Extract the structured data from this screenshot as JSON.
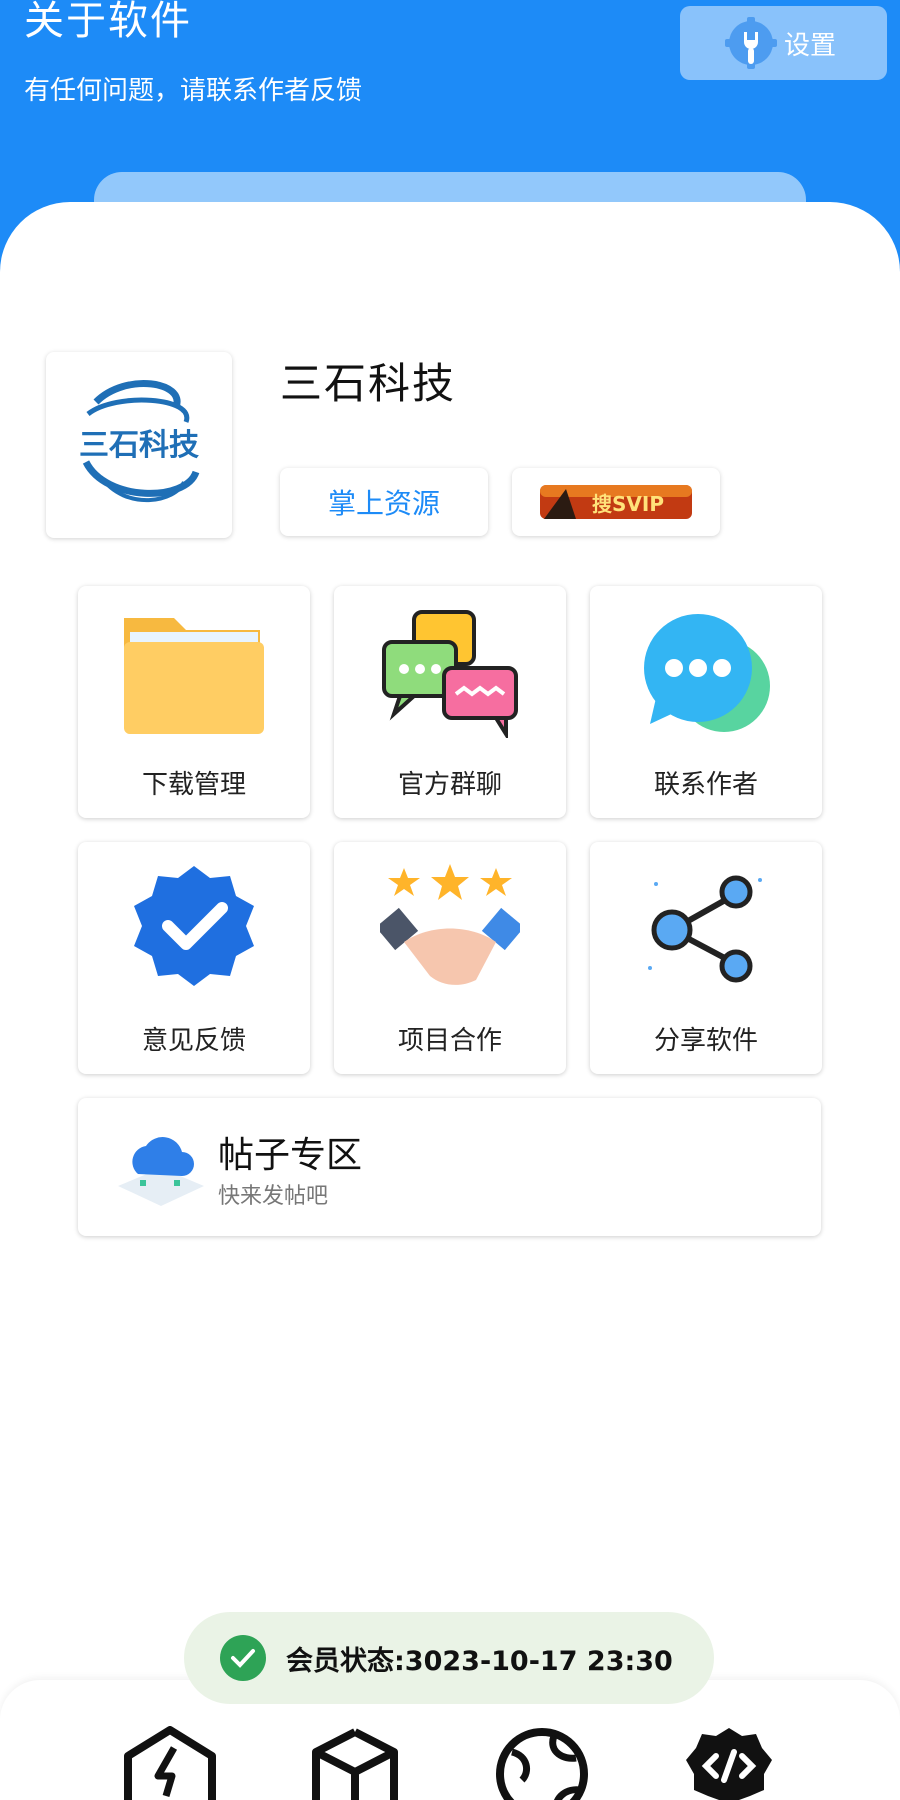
{
  "header": {
    "title": "关于软件",
    "subtitle": "有任何问题，请联系作者反馈",
    "settings_label": "设置"
  },
  "profile": {
    "logo_text": "三石科技",
    "company_name": "三石科技",
    "resource_button": "掌上资源",
    "svip_badge_text": "搜SVIP"
  },
  "grid": {
    "items": [
      {
        "label": "下载管理",
        "icon": "folder-icon"
      },
      {
        "label": "官方群聊",
        "icon": "group-chat-icon"
      },
      {
        "label": "联系作者",
        "icon": "chat-bubble-icon"
      },
      {
        "label": "意见反馈",
        "icon": "verified-badge-icon"
      },
      {
        "label": "项目合作",
        "icon": "handshake-icon"
      },
      {
        "label": "分享软件",
        "icon": "share-icon"
      }
    ]
  },
  "post_zone": {
    "title": "帖子专区",
    "subtitle": "快来发帖吧"
  },
  "toast": {
    "text": "会员状态:3023-10-17 23:30"
  },
  "bottom_nav": {
    "items": [
      "home-bolt-icon",
      "box-icon",
      "globe-icon",
      "code-gear-icon"
    ]
  },
  "colors": {
    "brand_blue": "#1d8bf7",
    "toast_bg": "#eaf3e6",
    "success_green": "#2ea356"
  }
}
